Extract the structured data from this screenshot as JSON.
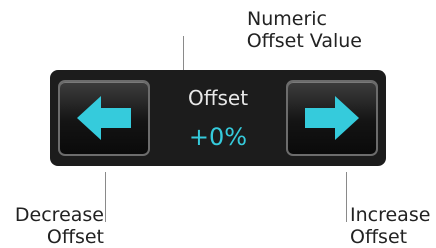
{
  "callouts": {
    "numeric_offset_line1": "Numeric",
    "numeric_offset_line2": "Offset Value",
    "decrease_line1": "Decrease",
    "decrease_line2": "Offset",
    "increase_line1": "Increase",
    "increase_line2": "Offset"
  },
  "offset": {
    "label": "Offset",
    "value": "+0%"
  },
  "buttons": {
    "decrease_icon": "left-arrow-icon",
    "increase_icon": "right-arrow-icon"
  },
  "colors": {
    "arrow": "#35cbdc",
    "panel": "#1c1c1c"
  }
}
